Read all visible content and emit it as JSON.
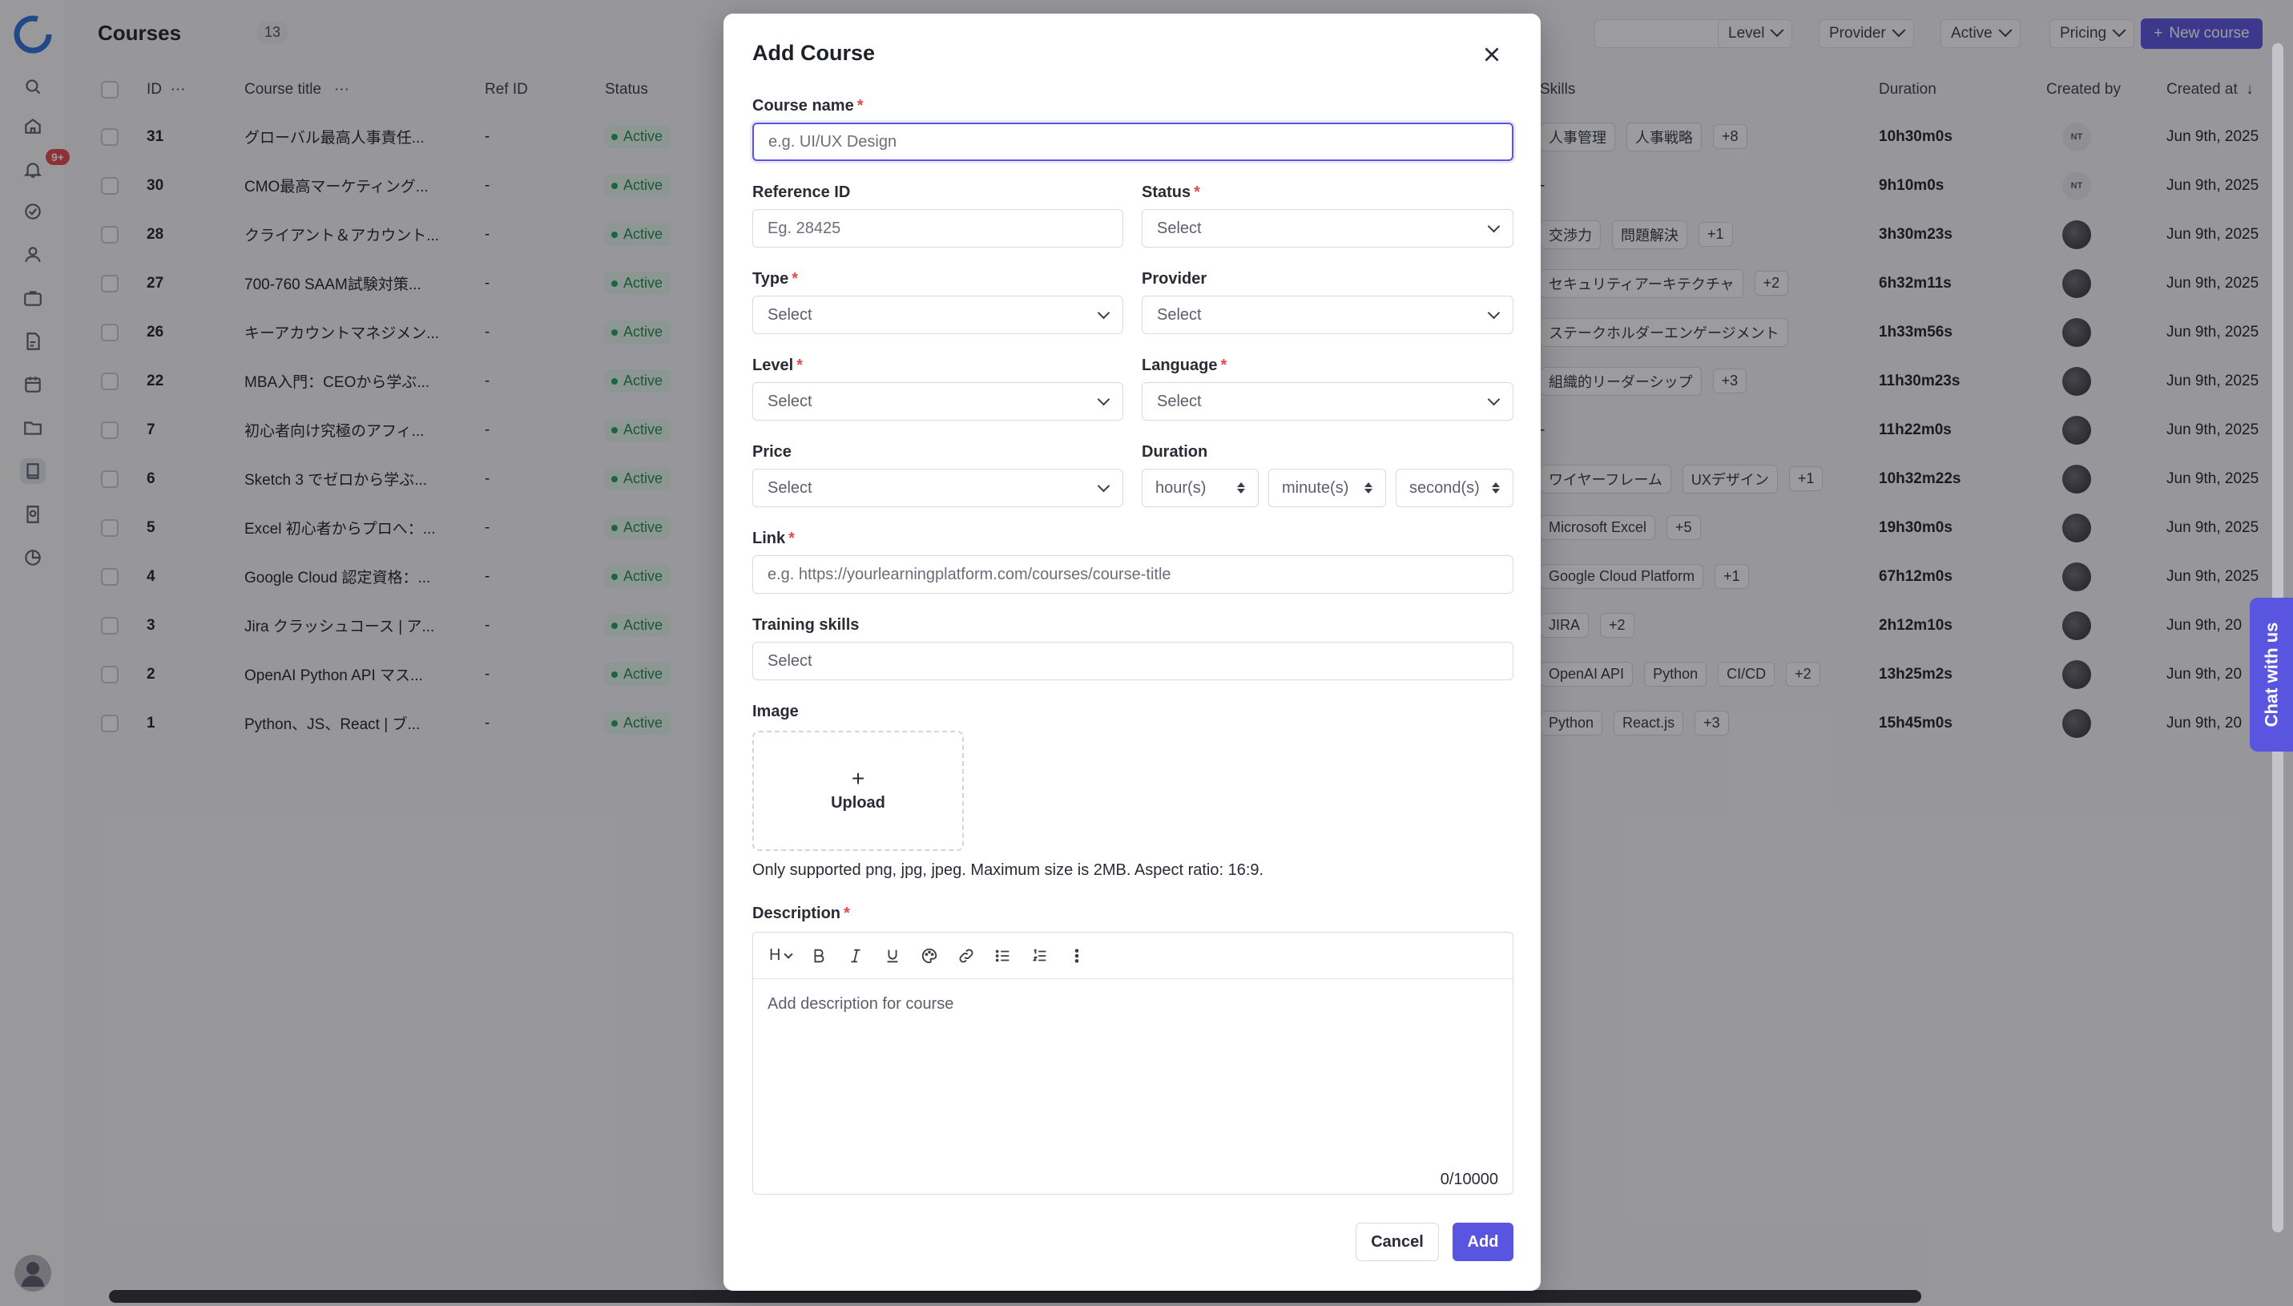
{
  "page": {
    "title": "Courses",
    "count": "13",
    "filters": [
      "Level",
      "Provider",
      "Active",
      "Pricing"
    ],
    "new_course_label": "New course"
  },
  "table": {
    "headers": {
      "id": "ID",
      "title": "Course title",
      "ref": "Ref ID",
      "status": "Status",
      "skills": "Skills",
      "duration": "Duration",
      "created_by": "Created by",
      "created_at": "Created at"
    },
    "rows": [
      {
        "id": "31",
        "title": "グローバル最高人事責任...",
        "ref": "-",
        "status": "Active",
        "skills": [
          "人事管理",
          "人事戦略"
        ],
        "more": "+8",
        "duration": "10h30m0s",
        "creator": "NT",
        "created_at": "Jun 9th, 2025"
      },
      {
        "id": "30",
        "title": "CMO最高マーケティング...",
        "ref": "-",
        "status": "Active",
        "skills": [
          "-"
        ],
        "more": "",
        "duration": "9h10m0s",
        "creator": "NT",
        "created_at": "Jun 9th, 2025"
      },
      {
        "id": "28",
        "title": "クライアント＆アカウント...",
        "ref": "-",
        "status": "Active",
        "skills": [
          "交渉力",
          "問題解決"
        ],
        "more": "+1",
        "duration": "3h30m23s",
        "creator": "",
        "created_at": "Jun 9th, 2025"
      },
      {
        "id": "27",
        "title": "700-760 SAAM試験対策...",
        "ref": "-",
        "status": "Active",
        "skills": [
          "セキュリティアーキテクチャ"
        ],
        "more": "+2",
        "duration": "6h32m11s",
        "creator": "",
        "created_at": "Jun 9th, 2025"
      },
      {
        "id": "26",
        "title": "キーアカウントマネジメン...",
        "ref": "-",
        "status": "Active",
        "skills": [
          "ステークホルダーエンゲージメント"
        ],
        "more": "",
        "duration": "1h33m56s",
        "creator": "",
        "created_at": "Jun 9th, 2025"
      },
      {
        "id": "22",
        "title": "MBA入門：CEOから学ぶ...",
        "ref": "-",
        "status": "Active",
        "skills": [
          "組織的リーダーシップ"
        ],
        "more": "+3",
        "duration": "11h30m23s",
        "creator": "",
        "created_at": "Jun 9th, 2025"
      },
      {
        "id": "7",
        "title": "初心者向け究極のアフィ...",
        "ref": "-",
        "status": "Active",
        "skills": [
          "-"
        ],
        "more": "",
        "duration": "11h22m0s",
        "creator": "",
        "created_at": "Jun 9th, 2025"
      },
      {
        "id": "6",
        "title": "Sketch 3 でゼロから学ぶ...",
        "ref": "-",
        "status": "Active",
        "skills": [
          "ワイヤーフレーム",
          "UXデザイン"
        ],
        "more": "+1",
        "duration": "10h32m22s",
        "creator": "",
        "created_at": "Jun 9th, 2025"
      },
      {
        "id": "5",
        "title": "Excel 初心者からプロへ：...",
        "ref": "-",
        "status": "Active",
        "skills": [
          "Microsoft Excel"
        ],
        "more": "+5",
        "duration": "19h30m0s",
        "creator": "",
        "created_at": "Jun 9th, 2025"
      },
      {
        "id": "4",
        "title": "Google Cloud 認定資格：...",
        "ref": "-",
        "status": "Active",
        "skills": [
          "Google Cloud Platform"
        ],
        "more": "+1",
        "duration": "67h12m0s",
        "creator": "",
        "created_at": "Jun 9th, 2025"
      },
      {
        "id": "3",
        "title": "Jira クラッシュコース | ア...",
        "ref": "-",
        "status": "Active",
        "skills": [
          "JIRA"
        ],
        "more": "+2",
        "duration": "2h12m10s",
        "creator": "",
        "created_at": "Jun 9th, 20"
      },
      {
        "id": "2",
        "title": "OpenAI Python API マス...",
        "ref": "-",
        "status": "Active",
        "skills": [
          "OpenAI API",
          "Python",
          "CI/CD"
        ],
        "more": "+2",
        "duration": "13h25m2s",
        "creator": "",
        "created_at": "Jun 9th, 20"
      },
      {
        "id": "1",
        "title": "Python、JS、React | ブ...",
        "ref": "-",
        "status": "Active",
        "skills": [
          "Python",
          "React.js"
        ],
        "more": "+3",
        "duration": "15h45m0s",
        "creator": "",
        "created_at": "Jun 9th, 20"
      }
    ]
  },
  "sidebar": {
    "notification_badge": "9+"
  },
  "chat_label": "Chat with us",
  "modal": {
    "title": "Add Course",
    "course_name_label": "Course name",
    "course_name_placeholder": "e.g. UI/UX Design",
    "reference_id_label": "Reference ID",
    "reference_id_placeholder": "Eg. 28425",
    "status_label": "Status",
    "type_label": "Type",
    "provider_label": "Provider",
    "level_label": "Level",
    "language_label": "Language",
    "price_label": "Price",
    "duration_label": "Duration",
    "select_text": "Select",
    "hours_placeholder": "hour(s)",
    "minutes_placeholder": "minute(s)",
    "seconds_placeholder": "second(s)",
    "link_label": "Link",
    "link_placeholder": "e.g. https://yourlearningplatform.com/courses/course-title",
    "training_skills_label": "Training skills",
    "image_label": "Image",
    "upload_label": "Upload",
    "image_hint": "Only supported png, jpg, jpeg. Maximum size is 2MB. Aspect ratio: 16:9.",
    "description_label": "Description",
    "description_placeholder": "Add description for course",
    "char_counter": "0/10000",
    "heading_tool": "H",
    "required_mark": "*",
    "cancel_label": "Cancel",
    "add_label": "Add"
  },
  "colors": {
    "accent": "#5a55e0",
    "status_active": "#1f8a4c",
    "required": "#e5484d"
  }
}
